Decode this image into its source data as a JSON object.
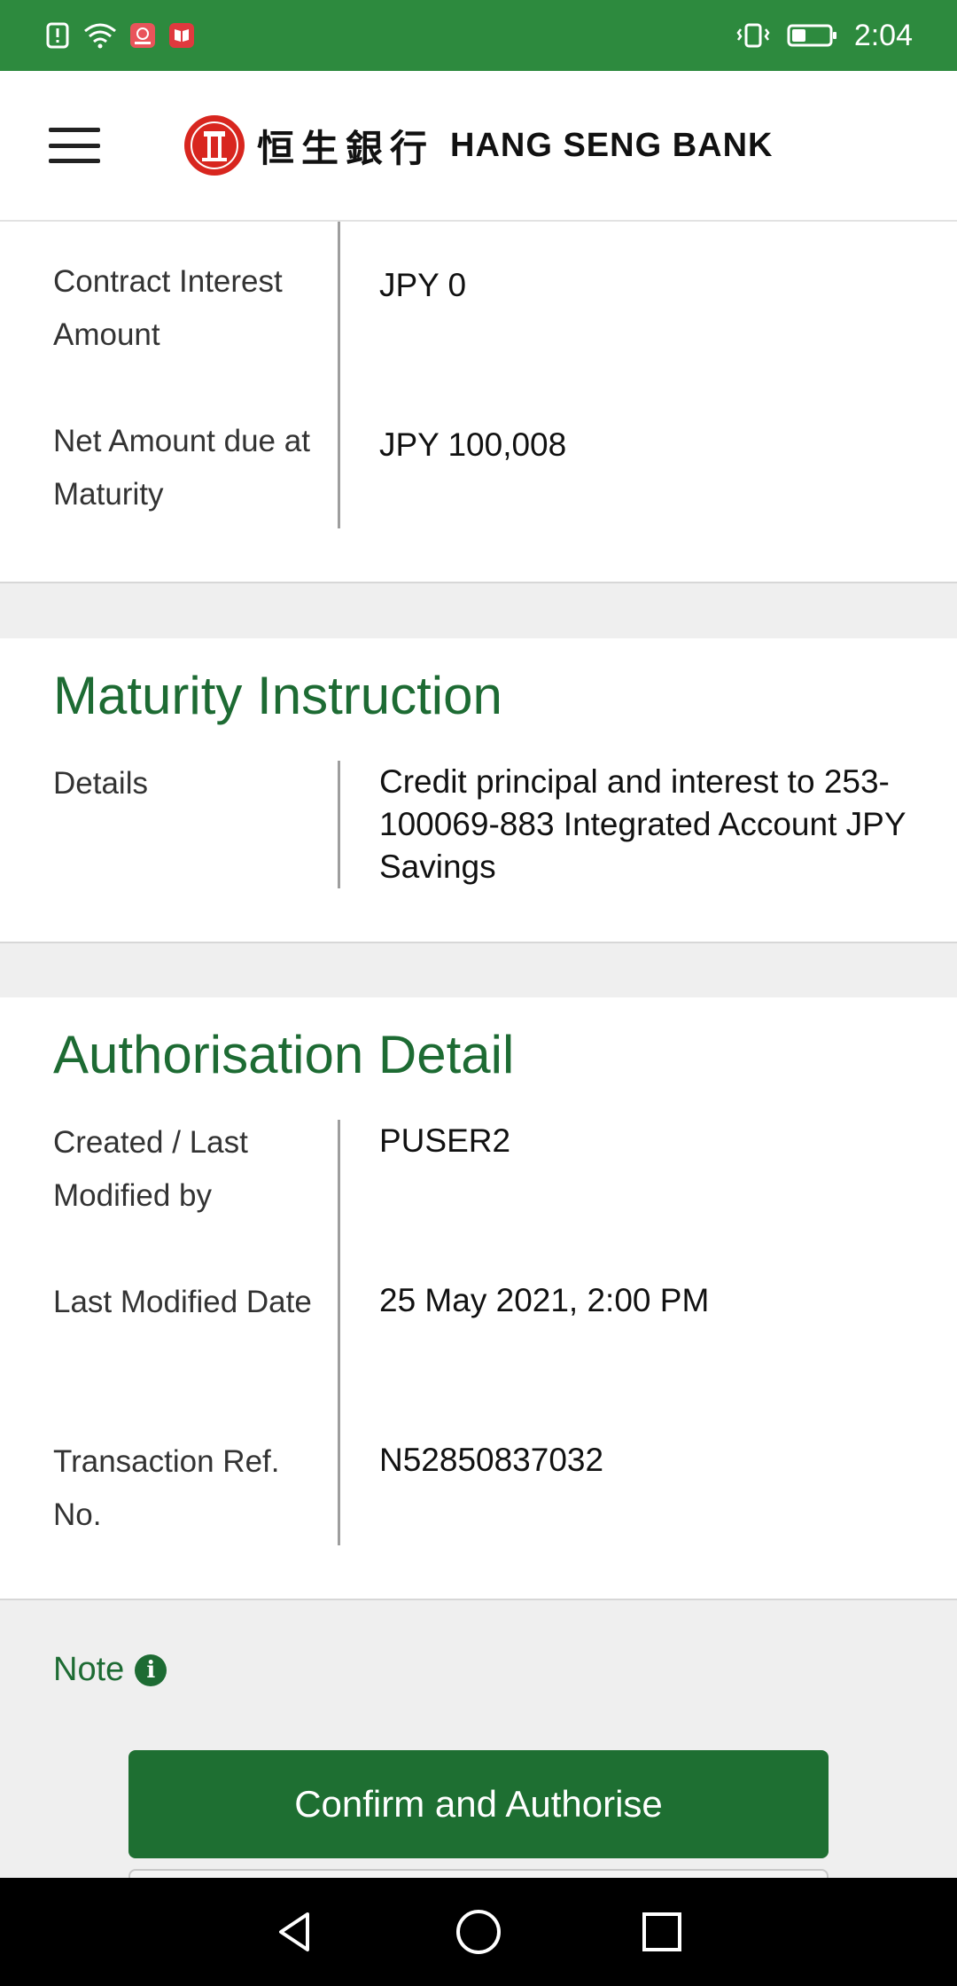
{
  "status_bar": {
    "time": "2:04",
    "icons": [
      "alert-icon",
      "wifi-icon",
      "huawei-icon",
      "book-icon",
      "vibrate-icon",
      "battery-icon"
    ]
  },
  "header": {
    "brand_cn": "恒生銀行",
    "brand_en": "HANG SENG BANK",
    "icons": [
      "menu-icon",
      "hang-seng-logo"
    ]
  },
  "deposit_summary": {
    "rows": [
      {
        "label": "Contract Interest Amount",
        "value": "JPY 0"
      },
      {
        "label": "Net Amount due at Maturity",
        "value": "JPY 100,008"
      }
    ]
  },
  "maturity_instruction": {
    "title": "Maturity Instruction",
    "rows": [
      {
        "label": "Details",
        "value": "Credit principal and interest to 253-100069-883 Integrated Account JPY Savings"
      }
    ]
  },
  "authorisation_detail": {
    "title": "Authorisation Detail",
    "rows": [
      {
        "label": "Created / Last Modified by",
        "value": "PUSER2"
      },
      {
        "label": "Last Modified Date",
        "value": "25 May 2021, 2:00 PM"
      },
      {
        "label": "Transaction Ref. No.",
        "value": "N52850837032"
      }
    ]
  },
  "note": {
    "label": "Note",
    "icon": "info-icon"
  },
  "actions": {
    "confirm_label": "Confirm and Authorise"
  },
  "nav": {
    "icons": [
      "back-icon",
      "home-icon",
      "recents-icon"
    ]
  },
  "colors": {
    "status_bar": "#2d8a3e",
    "title_green": "#1d6b33",
    "button_green": "#1e6f32",
    "logo_red": "#d8261f"
  }
}
